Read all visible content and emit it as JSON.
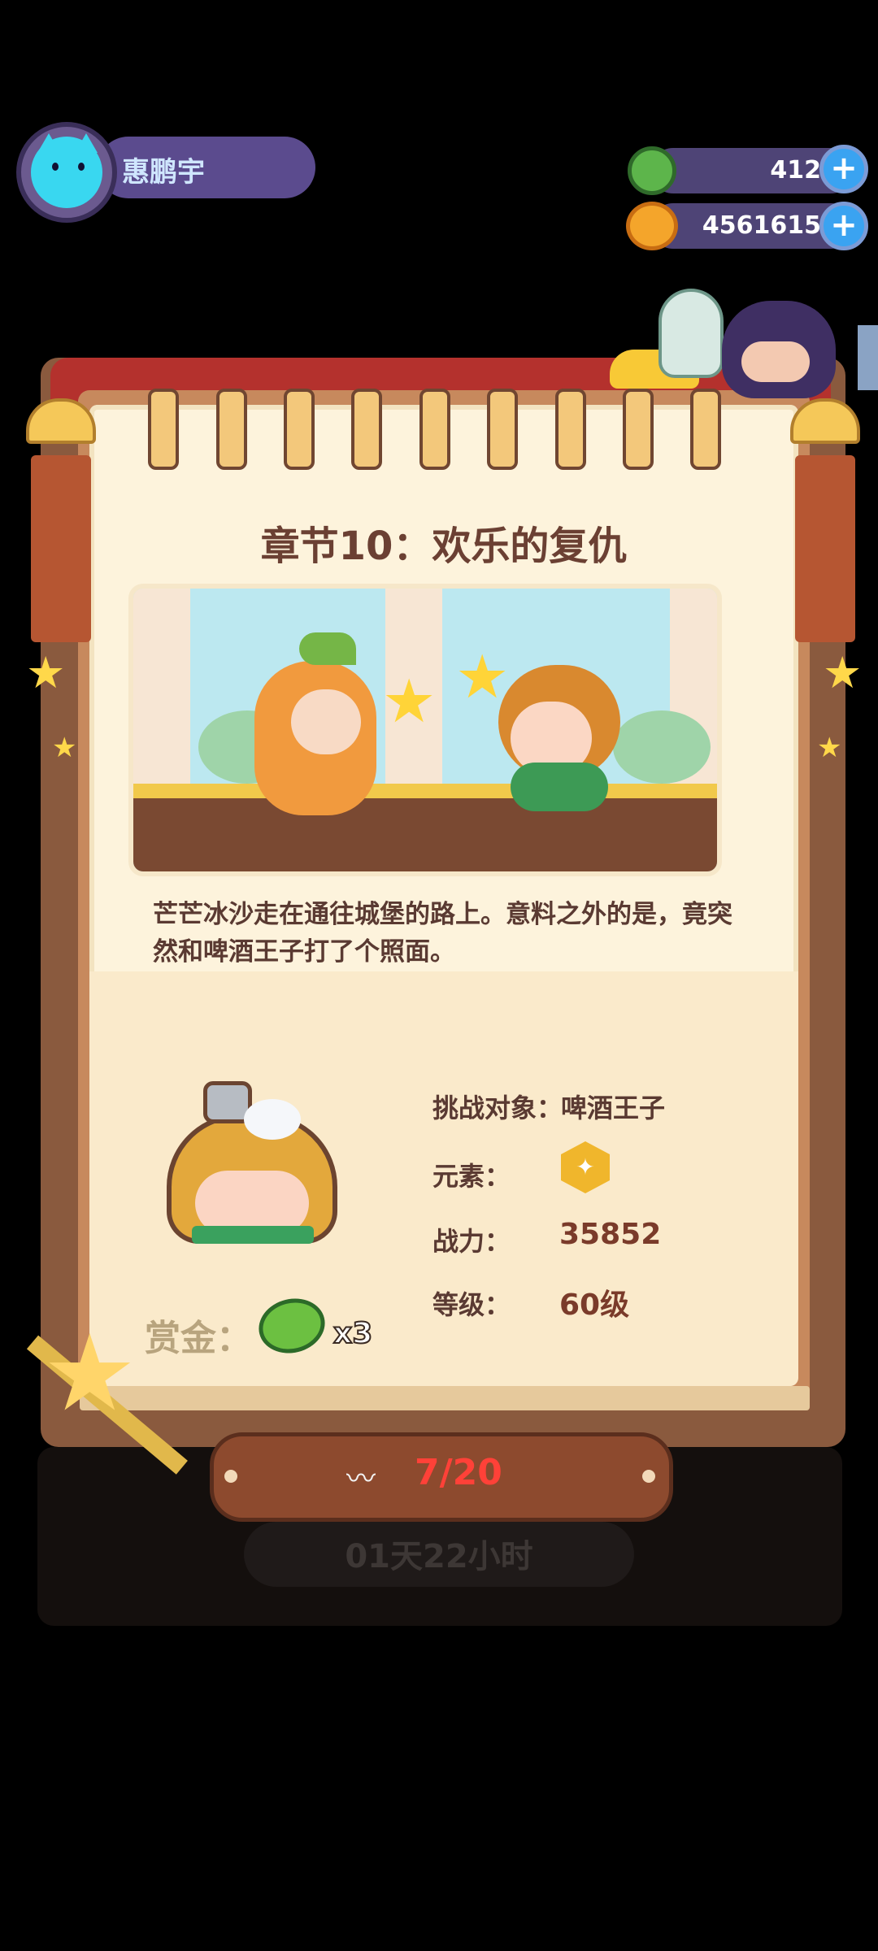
{
  "player": {
    "name": "惠鹏宇"
  },
  "currencies": [
    {
      "icon": "green-cap-gem-icon",
      "value": "412"
    },
    {
      "icon": "planet-coin-icon",
      "value": "4561615"
    }
  ],
  "chapter": {
    "title": "章节10：欢乐的复仇",
    "description": "芒芒冰沙走在通往城堡的路上。意料之外的是，竟突然和啤酒王子打了个照面。"
  },
  "challenge": {
    "target_label": "挑战对象：",
    "target_name": "啤酒王子",
    "element_label": "元素：",
    "element_icon": "hexagon-star-icon",
    "power_label": "战力：",
    "power_value": "35852",
    "level_label": "等级：",
    "level_value": "60级"
  },
  "reward": {
    "label": "赏金：",
    "multiplier": "x3",
    "icon": "green-bottle-cap-icon"
  },
  "progress": {
    "text": "7/20",
    "icon": "worm-icon"
  },
  "timer": {
    "text": "01天22小时"
  },
  "colors": {
    "accent_red": "#ff4138",
    "page_bg": "#fdf3dc",
    "wood": "#8d4a2e"
  }
}
